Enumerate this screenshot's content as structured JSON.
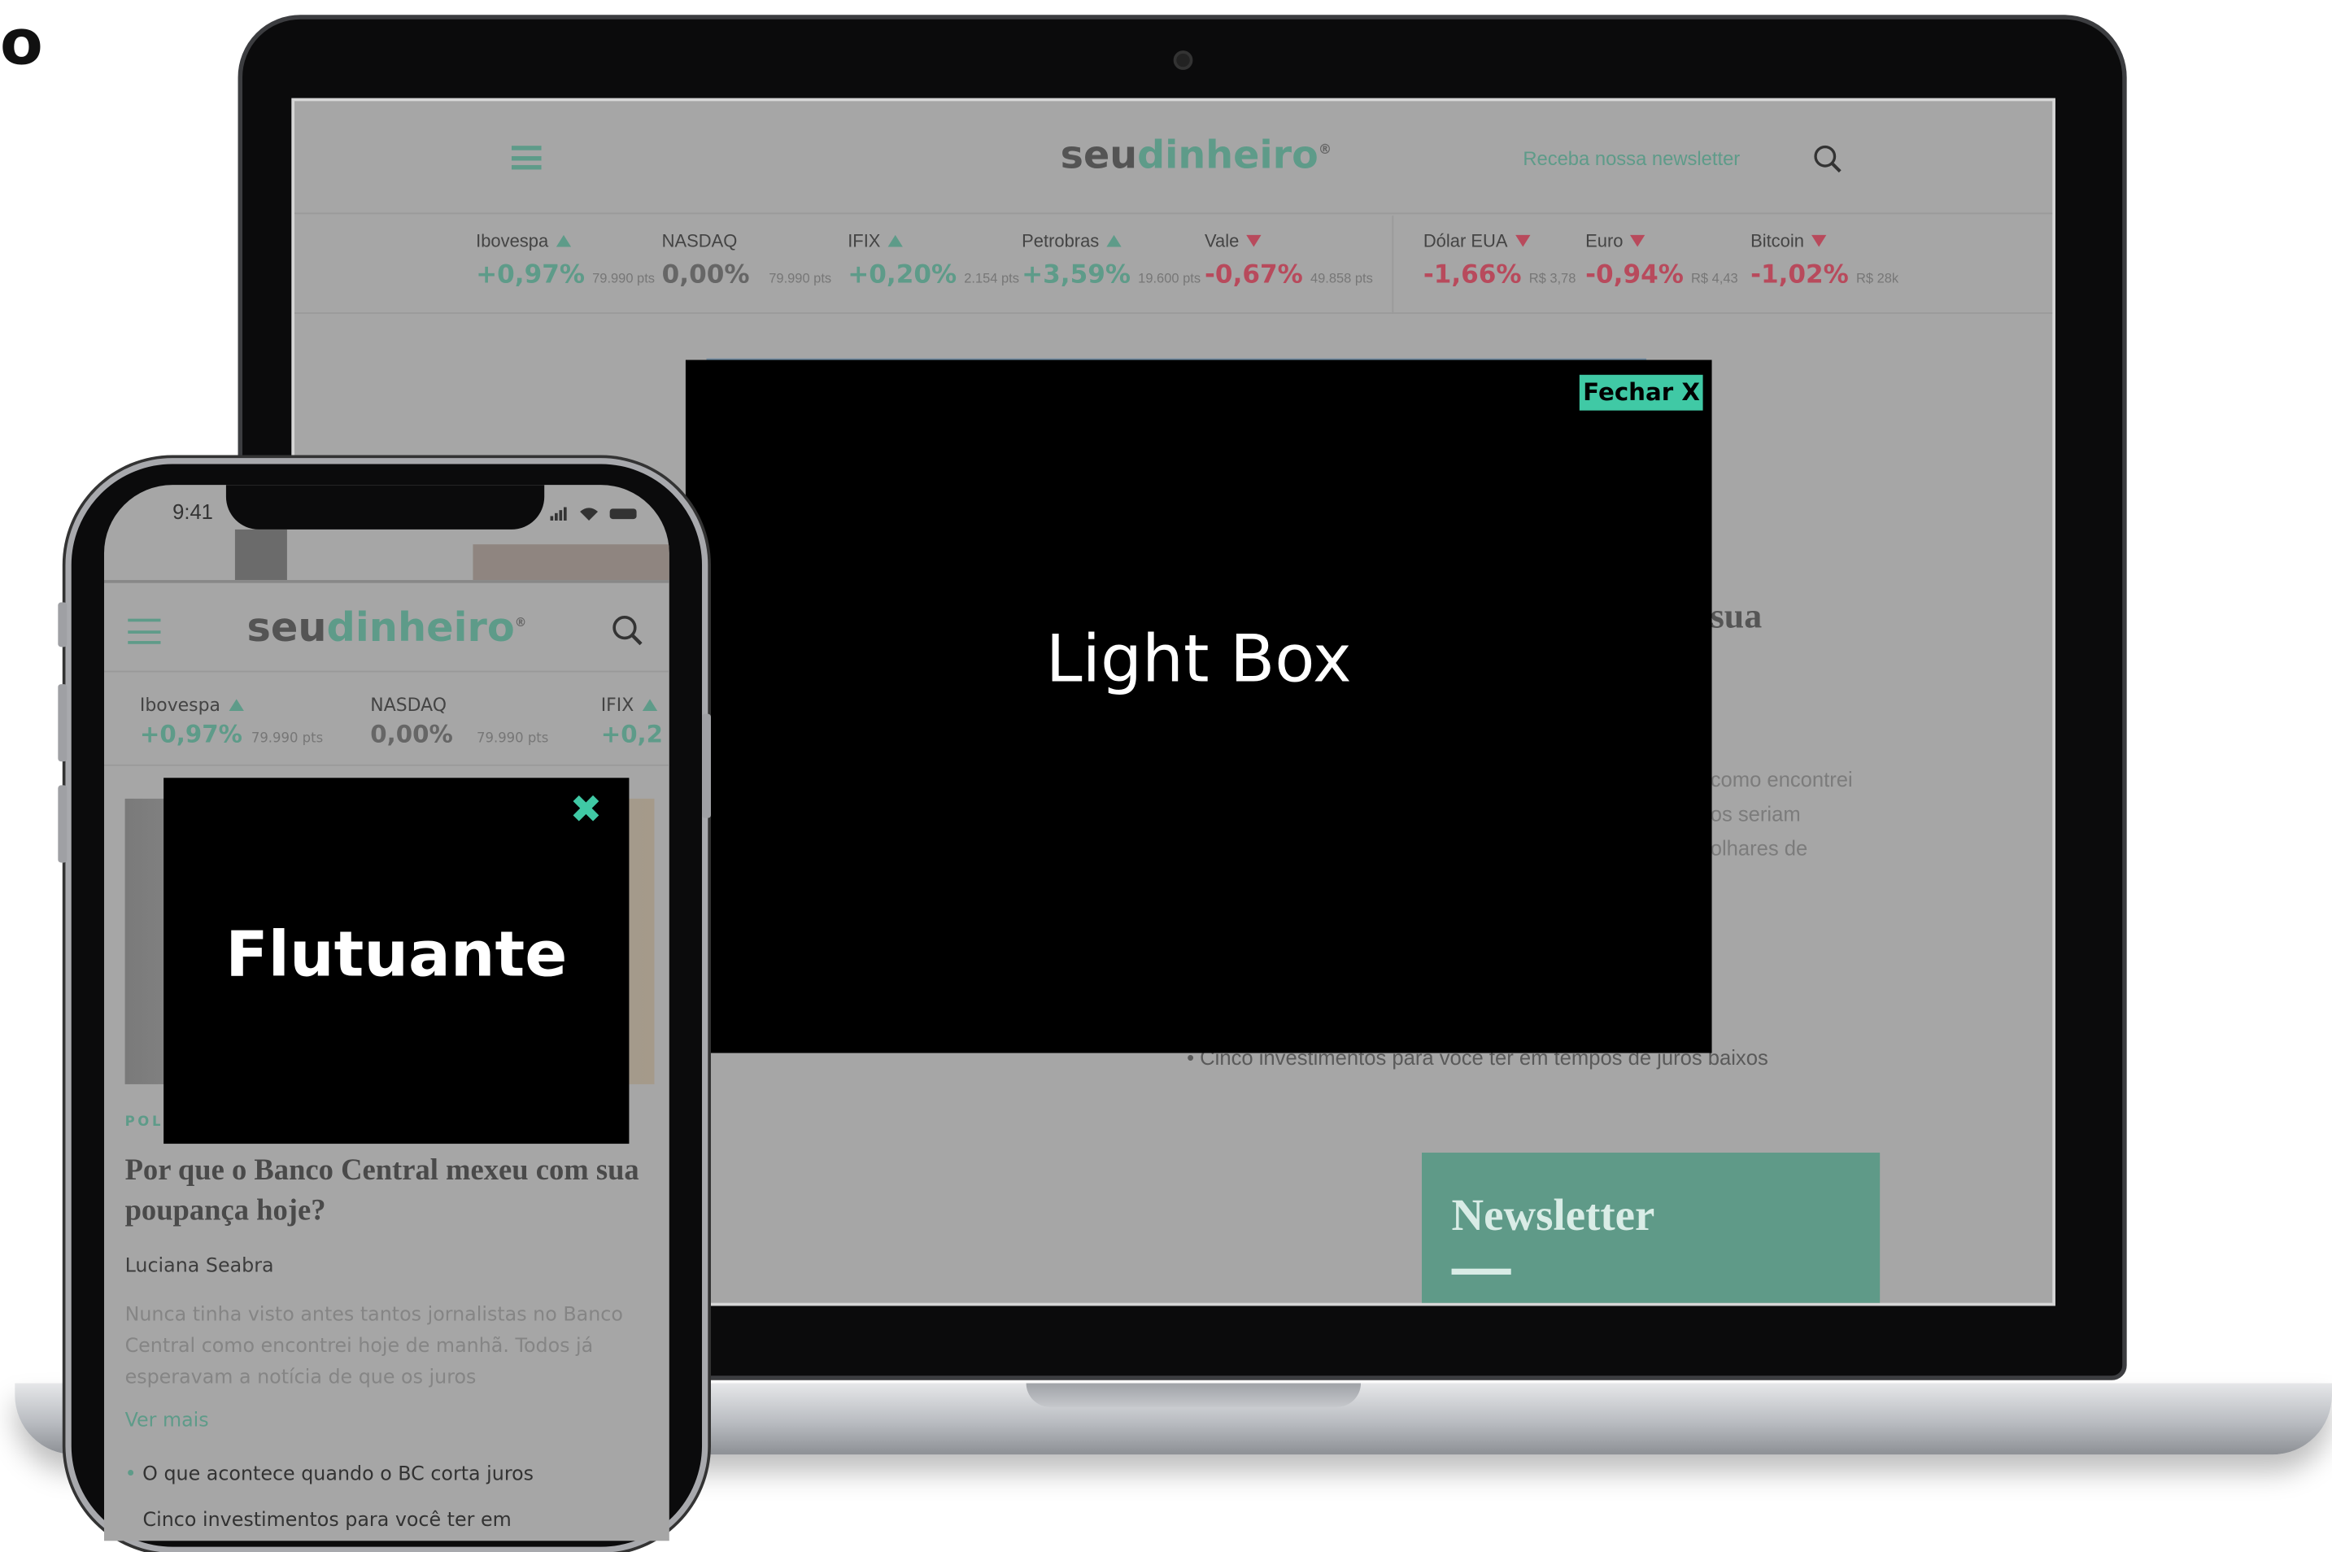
{
  "corner_text": "o",
  "desktop": {
    "logo_a": "seu",
    "logo_b": "dinheiro",
    "logo_mark": "®",
    "newsletter_link": "Receba nossa newsletter",
    "tickers": [
      {
        "name": "Ibovespa",
        "pct": "+0,97%",
        "pts": "79.990 pts",
        "dir": "up"
      },
      {
        "name": "NASDAQ",
        "pct": "0,00%",
        "pts": "79.990 pts",
        "dir": "none"
      },
      {
        "name": "IFIX",
        "pct": "+0,20%",
        "pts": "2.154 pts",
        "dir": "up"
      },
      {
        "name": "Petrobras",
        "pct": "+3,59%",
        "pts": "19.600 pts",
        "dir": "up"
      },
      {
        "name": "Vale",
        "pct": "-0,67%",
        "pts": "49.858 pts",
        "dir": "down"
      },
      {
        "name": "Dólar EUA",
        "pct": "-1,66%",
        "pts": "R$ 3,78",
        "dir": "down"
      },
      {
        "name": "Euro",
        "pct": "-0,94%",
        "pts": "R$ 4,43",
        "dir": "down"
      },
      {
        "name": "Bitcoin",
        "pct": "-1,02%",
        "pts": "R$ 28k",
        "dir": "down"
      }
    ],
    "fragment_sua": "sua",
    "fragment_lines": [
      "como encontrei",
      "os seriam",
      "olhares de"
    ],
    "bullet": "Cinco investimentos para você ter em tempos de juros baixos",
    "newsletter_title": "Newsletter",
    "lightbox_title": "Light Box",
    "lightbox_close": "Fechar X"
  },
  "phone": {
    "time": "9:41",
    "logo_a": "seu",
    "logo_b": "dinheiro",
    "logo_mark": "®",
    "tickers": [
      {
        "name": "Ibovespa",
        "pct": "+0,97%",
        "pts": "79.990 pts",
        "dir": "up"
      },
      {
        "name": "NASDAQ",
        "pct": "0,00%",
        "pts": "79.990 pts",
        "dir": "none"
      },
      {
        "name": "IFIX",
        "pct": "+0,2",
        "pts": "",
        "dir": "up"
      }
    ],
    "category": "POL",
    "article_title": "Por que o Banco Central mexeu com sua poupança hoje?",
    "author": "Luciana Seabra",
    "excerpt": "Nunca tinha visto antes tantos jornalistas no Banco Central como encontrei hoje de manhã. Todos já esperavam a notícia de que os juros",
    "read_more": "Ver mais",
    "related_1": "O que acontece quando o BC corta juros",
    "related_2": "Cinco investimentos para você ter em",
    "float_title": "Flutuante",
    "float_close": "✖"
  }
}
